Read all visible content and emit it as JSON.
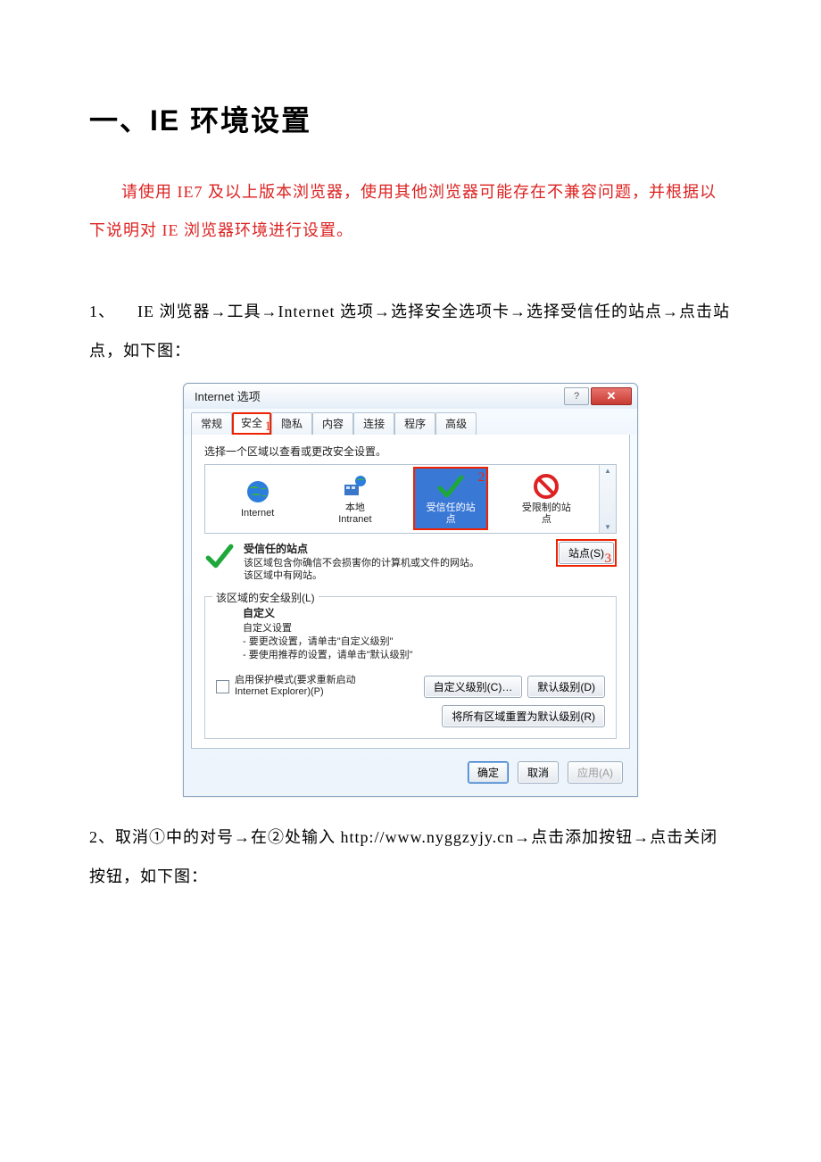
{
  "heading": "一、IE 环境设置",
  "intro": "请使用 IE7 及以上版本浏览器，使用其他浏览器可能存在不兼容问题，并根据以下说明对 IE 浏览器环境进行设置。",
  "steps": {
    "s1": {
      "num": "1、",
      "text": "IE 浏览器→工具→Internet 选项→选择安全选项卡→选择受信任的站点→点击站点，如下图："
    },
    "s2": {
      "num": "2、",
      "text": "取消①中的对号→在②处输入 http://www.nyggzyjy.cn→点击添加按钮→点击关闭按钮，如下图："
    }
  },
  "dialog": {
    "title": "Internet 选项",
    "help": "?",
    "close": "✕",
    "tabs": [
      "常规",
      "安全",
      "隐私",
      "内容",
      "连接",
      "程序",
      "高级"
    ],
    "marks": {
      "m1": "1",
      "m2": "2",
      "m3": "3"
    },
    "zone_prompt": "选择一个区域以查看或更改安全设置。",
    "zones": {
      "internet": "Internet",
      "intranet_l1": "本地",
      "intranet_l2": "Intranet",
      "trusted_l1": "受信任的站",
      "trusted_l2": "点",
      "restricted_l1": "受限制的站",
      "restricted_l2": "点"
    },
    "trusted_title": "受信任的站点",
    "trusted_desc1": "该区域包含你确信不会损害你的计算机或文件的网站。",
    "trusted_desc2": "该区域中有网站。",
    "sites_btn": "站点(S)",
    "sec_level_legend": "该区域的安全级别(L)",
    "custom_bold": "自定义",
    "custom_l1": "自定义设置",
    "custom_l2": "- 要更改设置，请单击\"自定义级别\"",
    "custom_l3": "- 要使用推荐的设置，请单击\"默认级别\"",
    "protected_l1": "启用保护模式(要求重新启动",
    "protected_l2": "Internet Explorer)(P)",
    "btn_custom_level": "自定义级别(C)…",
    "btn_default_level": "默认级别(D)",
    "btn_reset_all": "将所有区域重置为默认级别(R)",
    "btn_ok": "确定",
    "btn_cancel": "取消",
    "btn_apply": "应用(A)"
  }
}
